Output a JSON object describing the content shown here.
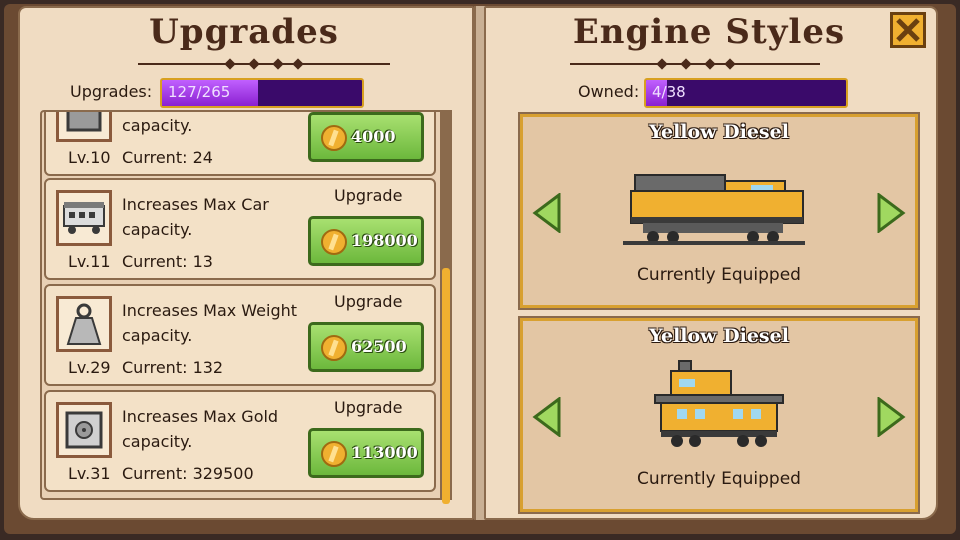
{
  "left": {
    "title": "Upgrades",
    "stat_label": "Upgrades:",
    "progress_text": "127/265",
    "progress_fraction": 0.479
  },
  "right": {
    "title": "Engine Styles",
    "stat_label": "Owned:",
    "progress_text": "4/38",
    "progress_fraction": 0.105
  },
  "upgrades": [
    {
      "icon": "box-icon",
      "desc_line2": "capacity.",
      "level": "Lv.10",
      "current": "Current: 24",
      "upgrade_label": "",
      "price": "4000"
    },
    {
      "icon": "passenger-car-icon",
      "desc_line1": "Increases Max Car",
      "desc_line2": "capacity.",
      "level": "Lv.11",
      "current": "Current: 13",
      "upgrade_label": "Upgrade",
      "price": "198000"
    },
    {
      "icon": "weight-icon",
      "desc_line1": "Increases Max Weight",
      "desc_line2": "capacity.",
      "level": "Lv.29",
      "current": "Current: 132",
      "upgrade_label": "Upgrade",
      "price": "62500"
    },
    {
      "icon": "safe-icon",
      "desc_line1": "Increases Max Gold",
      "desc_line2": "capacity.",
      "level": "Lv.31",
      "current": "Current: 329500",
      "upgrade_label": "Upgrade",
      "price": "113000"
    }
  ],
  "styles": [
    {
      "name": "Yellow Diesel",
      "status": "Currently Equipped",
      "icon": "diesel-locomotive-icon"
    },
    {
      "name": "Yellow Diesel",
      "status": "Currently Equipped",
      "icon": "caboose-icon"
    }
  ],
  "colors": {
    "page": "#f0dcc2",
    "progress_purple": "#8a20d0",
    "button_green": "#6cb83c",
    "engine_yellow": "#f0b030"
  }
}
